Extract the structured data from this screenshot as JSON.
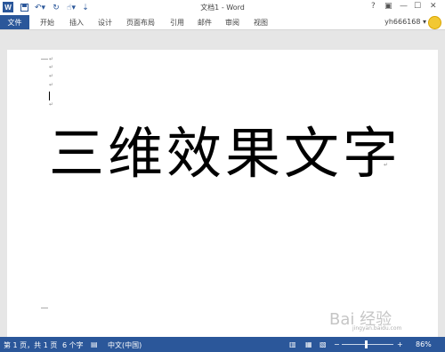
{
  "window": {
    "title": "文档1 - Word",
    "help": "?",
    "min": "—",
    "max": "☐",
    "close": "✕"
  },
  "qat": {
    "logo": "W",
    "save_icon": "save-icon",
    "undo_icon": "undo-icon",
    "redo_icon": "redo-icon",
    "touch_icon": "touch-mode-icon",
    "customize": "⇣"
  },
  "ribbon": {
    "file": "文件",
    "tabs": [
      "开始",
      "插入",
      "设计",
      "页面布局",
      "引用",
      "邮件",
      "审阅",
      "视图"
    ],
    "user": "yh666168 ▾"
  },
  "document": {
    "text": "三维效果文字",
    "para_mark": "↵"
  },
  "status": {
    "page": "第 1 页，共 1 页",
    "words": "6 个字",
    "lang": "中文(中国)",
    "zoom_minus": "−",
    "zoom_plus": "+",
    "zoom": "86%"
  },
  "colors": {
    "accent": "#2b579a"
  },
  "watermark": {
    "main": "Bai 经验",
    "sub": "jingyan.baidu.com"
  }
}
